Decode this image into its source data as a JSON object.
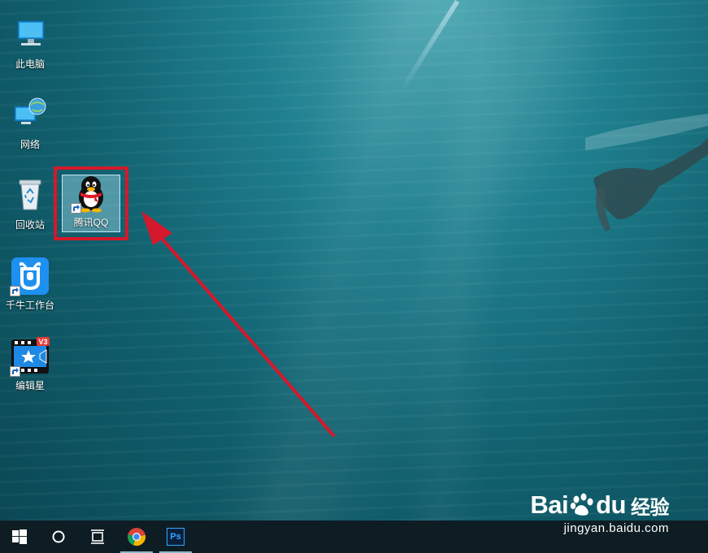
{
  "desktop": {
    "icons": [
      {
        "label": "此电脑",
        "icon": "this-pc-icon"
      },
      {
        "label": "网络",
        "icon": "network-icon"
      },
      {
        "label": "回收站",
        "icon": "recycle-bin-icon"
      },
      {
        "label": "腾讯QQ",
        "icon": "qq-penguin-icon",
        "selected": true,
        "highlighted": true
      },
      {
        "label": "千牛工作台",
        "icon": "qianniu-icon"
      },
      {
        "label": "编辑星",
        "icon": "editor-star-icon",
        "badge": "V3"
      }
    ],
    "highlight_color": "#d3192b"
  },
  "taskbar": {
    "items": [
      "windows-start-icon",
      "search-circle-icon",
      "task-view-icon",
      "chrome-icon",
      "photoshop-icon"
    ],
    "photoshop_text": "Ps"
  },
  "watermark": {
    "logo_left": "Bai",
    "logo_right": "du",
    "logo_suffix": "经验",
    "url": "jingyan.baidu.com"
  }
}
